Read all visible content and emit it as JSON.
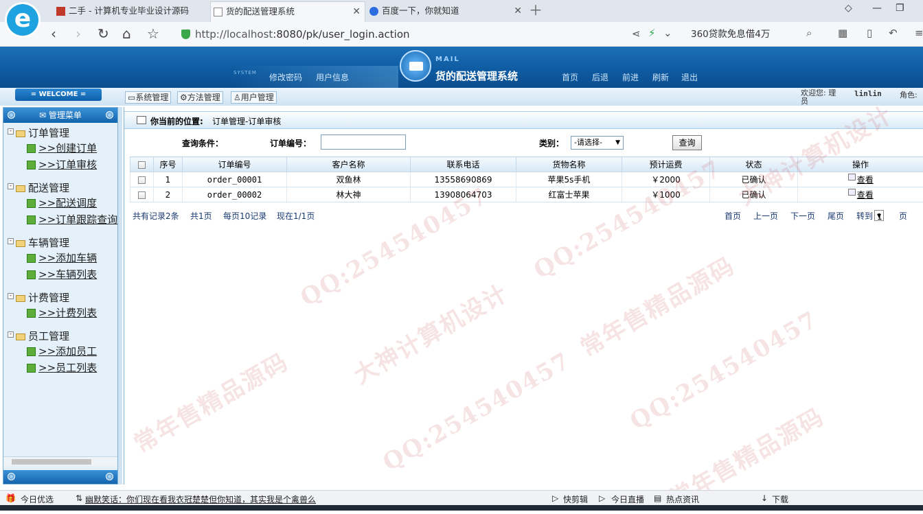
{
  "browser": {
    "tabs": [
      {
        "title": "二手 - 计算机专业毕业设计源码"
      },
      {
        "title": "货的配送管理系统"
      },
      {
        "title": "百度一下，你就知道"
      }
    ],
    "url_host": "http://localhost",
    "url_rest": ":8080/pk/user_login.action",
    "ad_text": "360贷款免息借4万"
  },
  "header": {
    "system_word": "SYSTEM",
    "links": [
      "修改密码",
      "用户信息"
    ],
    "mail_word": "MAIL",
    "title": "货的配送管理系统",
    "nav": [
      "首页",
      "后退",
      "前进",
      "刷新",
      "退出"
    ]
  },
  "subbar": {
    "welcome": "= WELCOME =",
    "tabs": [
      "系统管理",
      "方法管理",
      "用户管理"
    ],
    "welcome_user_label": "欢迎您: 理员",
    "user": "linlin",
    "role_label": "角色:"
  },
  "sidebar": {
    "title": "管理菜单",
    "groups": [
      {
        "label": "订单管理",
        "items": [
          ">>创建订单",
          ">>订单审核"
        ]
      },
      {
        "label": "配送管理",
        "items": [
          ">>配送调度",
          ">>订单跟踪查询"
        ]
      },
      {
        "label": "车辆管理",
        "items": [
          ">>添加车辆",
          ">>车辆列表"
        ]
      },
      {
        "label": "计费管理",
        "items": [
          ">>计费列表"
        ]
      },
      {
        "label": "员工管理",
        "items": [
          ">>添加员工",
          ">>员工列表"
        ]
      }
    ]
  },
  "main": {
    "location_label": "你当前的位置:",
    "location_path": "订单管理-订单审核",
    "query_label": "查询条件：",
    "order_no_label": "订单编号：",
    "order_no_value": "",
    "type_label": "类别：",
    "type_selected": "-请选择-",
    "query_button": "查询",
    "columns": [
      "序号",
      "订单编号",
      "客户名称",
      "联系电话",
      "货物名称",
      "预计运费",
      "状态",
      "操作"
    ],
    "rows": [
      {
        "no": "1",
        "order": "order_00001",
        "customer": "双鱼林",
        "phone": "13558690869",
        "goods": "苹果5s手机",
        "fee": "￥2000",
        "status": "已确认",
        "action": "查看"
      },
      {
        "no": "2",
        "order": "order_00002",
        "customer": "林大神",
        "phone": "13908064703",
        "goods": "红富士苹果",
        "fee": "￥1000",
        "status": "已确认",
        "action": "查看"
      }
    ],
    "pager": {
      "total": "共有记录2条",
      "pages": "共1页",
      "per_page": "每页10记录",
      "current": "现在1/1页",
      "first": "首页",
      "prev": "上一页",
      "next": "下一页",
      "last": "尾页",
      "goto": "转到",
      "goto_value": "1",
      "page_suffix": "页"
    }
  },
  "statusbar": {
    "left": "今日优选",
    "news": "幽默笑话：你们现在看我衣冠楚楚但你知道，其实我是个禽兽么",
    "items": [
      "快剪辑",
      "今日直播",
      "热点资讯",
      "下载"
    ]
  },
  "watermarks": [
    "QQ:254540457",
    "大神计算机设计",
    "常年售精品源码"
  ],
  "colors": {
    "header": "#0e5aa0",
    "accent": "#1264ae",
    "link": "#1a3a72"
  }
}
